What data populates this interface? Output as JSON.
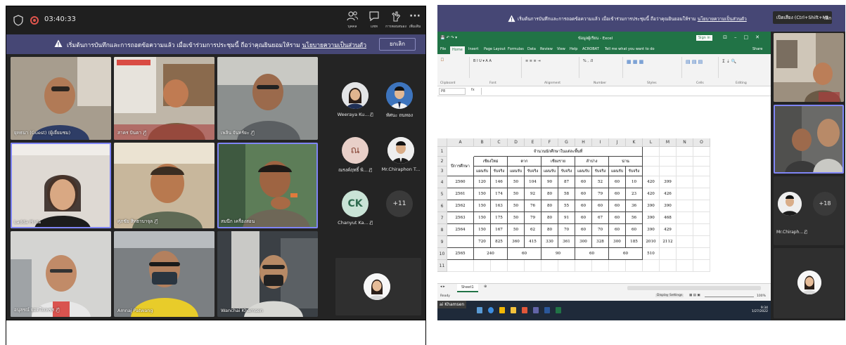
{
  "left": {
    "topbar": {
      "timer": "03:40:33",
      "buttons": [
        {
          "icon": "people-icon",
          "label": "บุคคล"
        },
        {
          "icon": "chat-icon",
          "label": "แชท"
        },
        {
          "icon": "reactions-icon",
          "label": "การตอบสนอง"
        },
        {
          "icon": "more-icon",
          "label": "เพิ่มเติม"
        }
      ]
    },
    "banner": {
      "text": "เริ่มต้นการบันทึกและการถอดข้อความแล้ว เมื่อเข้าร่วมการประชุมนี้ ถือว่าคุณยินยอมให้ราม",
      "link": "นโยบายความเป็นส่วนตัว",
      "dismiss": "ยกเลิก"
    },
    "tiles": [
      {
        "name": "ยุทธนา (Guest) (ผู้เยี่ยมชม)",
        "mic": false
      },
      {
        "name": "สาคร ปันตา",
        "mic": true
      },
      {
        "name": "เพลิน จันทร์ยะ",
        "mic": true
      },
      {
        "name": "Ladda Pinta",
        "mic": false
      },
      {
        "name": "ศุภชัย สิทธาบาจุล",
        "mic": true
      },
      {
        "name": "สมนึก เครื่องสอน",
        "mic": false
      },
      {
        "name": "อนุสรณ์ ยอดใจเพชร",
        "mic": true
      },
      {
        "name": "Amnaj Patwang",
        "mic": false
      },
      {
        "name": "Wanchai Khamsen",
        "mic": false
      }
    ],
    "roster": [
      {
        "name": "Weeraya Ku...",
        "mic": true
      },
      {
        "name": "ทัศนะ ถนทอง",
        "mic": false
      },
      {
        "name": "ณรงค์ฤทธิ์ พิ...",
        "mic": true,
        "initials": "ณ"
      },
      {
        "name": "Mr.Chiraphon T...",
        "mic": false
      },
      {
        "name": "Chanyut Ka...",
        "mic": true,
        "initials": "CK"
      },
      {
        "name": "",
        "count": "+11"
      }
    ]
  },
  "right": {
    "banner": {
      "text": "เริ่มต้นการบันทึกและการถอดข้อความแล้ว เมื่อเข้าร่วมการประชุมนี้ ถือว่าคุณยินยอมให้ราม",
      "link": "นโยบายความเป็นส่วนตัว",
      "tooltip": "เปิดเสียง (Ctrl+Shift+M)",
      "dismiss": "เลิก"
    },
    "excel": {
      "window_title": "ข้อมูลผู้เรียน - Excel",
      "sign_in": "Sign in",
      "tabs": [
        "File",
        "Home",
        "Insert",
        "Page Layout",
        "Formulas",
        "Data",
        "Review",
        "View",
        "Help",
        "ACROBAT",
        "Tell me what you want to do"
      ],
      "share": "Share",
      "ribbon_groups": [
        "Clipboard",
        "Font",
        "Alignment",
        "Number",
        "Styles",
        "Cells",
        "Editing"
      ],
      "name_box": "P8",
      "fx": "fx",
      "columns": [
        "A",
        "B",
        "C",
        "D",
        "E",
        "F",
        "G",
        "H",
        "I",
        "J",
        "K",
        "L",
        "M",
        "N",
        "O"
      ],
      "row_numbers": [
        "1",
        "2",
        "3",
        "4",
        "5",
        "6",
        "7",
        "8",
        "9",
        "10",
        "11"
      ],
      "table": {
        "title": "จำนวนนักศึกษาในแต่ละพื้นที่",
        "year_header": "ปีการศึกษา",
        "areas": [
          "เชียงใหม่",
          "ตาก",
          "เชียงราย",
          "ลำปาง",
          "น่าน"
        ],
        "sub": [
          "แผนรับ",
          "รับจริง"
        ],
        "rows": [
          [
            "2560",
            "120",
            "146",
            "50",
            "104",
            "90",
            "87",
            "60",
            "52",
            "60",
            "10",
            "420",
            "399"
          ],
          [
            "2561",
            "150",
            "174",
            "50",
            "92",
            "80",
            "58",
            "60",
            "79",
            "60",
            "23",
            "420",
            "426"
          ],
          [
            "2562",
            "150",
            "163",
            "50",
            "76",
            "80",
            "55",
            "60",
            "60",
            "60",
            "36",
            "390",
            "390"
          ],
          [
            "2563",
            "150",
            "175",
            "50",
            "79",
            "80",
            "91",
            "60",
            "67",
            "60",
            "56",
            "390",
            "468"
          ],
          [
            "2564",
            "150",
            "167",
            "50",
            "62",
            "80",
            "70",
            "60",
            "70",
            "60",
            "60",
            "390",
            "429"
          ],
          [
            "",
            "720",
            "825",
            "360",
            "415",
            "330",
            "361",
            "300",
            "328",
            "300",
            "185",
            "2010",
            "2112"
          ]
        ],
        "row2565": [
          "2565",
          "240",
          "60",
          "90",
          "60",
          "60",
          "510"
        ]
      },
      "sheet_tab": "Sheet1",
      "status": "Ready",
      "display_settings": "Display Settings",
      "zoom": "100%",
      "taskbar_name": "ai Khamsen",
      "clock_time": "9:34",
      "clock_date": "1/27/2022"
    },
    "side": [
      {
        "name": ""
      },
      {
        "name": ""
      },
      {
        "name": "Mr.Chiraph...",
        "mic": true
      },
      {
        "count": "+18"
      }
    ]
  }
}
